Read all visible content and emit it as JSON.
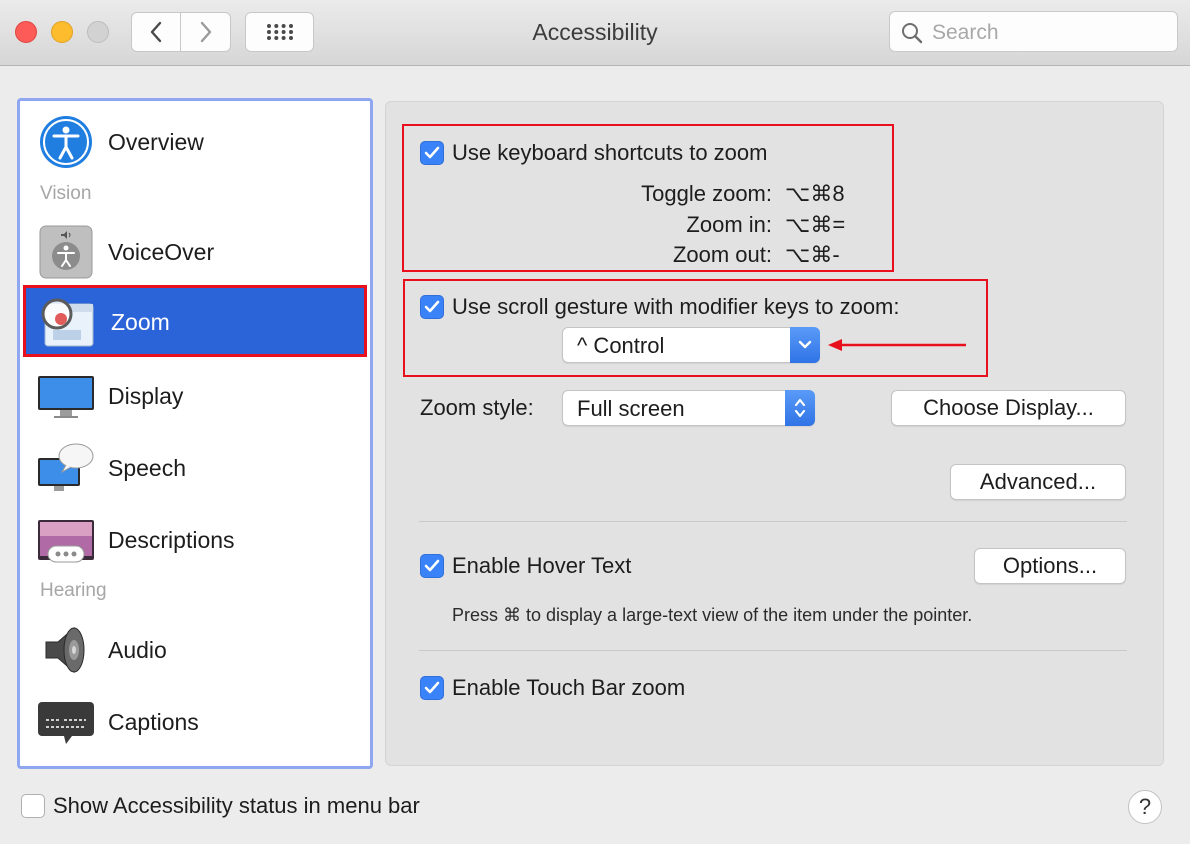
{
  "window": {
    "title": "Accessibility",
    "search_placeholder": "Search"
  },
  "sidebar": {
    "items": [
      {
        "label": "Overview",
        "icon": "accessibility-icon"
      },
      {
        "label": "VoiceOver",
        "icon": "voiceover-icon"
      },
      {
        "label": "Zoom",
        "icon": "zoom-icon",
        "selected": true
      },
      {
        "label": "Display",
        "icon": "display-icon"
      },
      {
        "label": "Speech",
        "icon": "speech-icon"
      },
      {
        "label": "Descriptions",
        "icon": "descriptions-icon"
      },
      {
        "label": "Audio",
        "icon": "speaker-icon"
      },
      {
        "label": "Captions",
        "icon": "captions-icon"
      }
    ],
    "headers": {
      "vision": "Vision",
      "hearing": "Hearing"
    }
  },
  "zoom": {
    "keyboard_shortcuts": {
      "label": "Use keyboard shortcuts to zoom",
      "checked": true,
      "shortcuts": [
        {
          "label": "Toggle zoom:",
          "keys": "⌥⌘8"
        },
        {
          "label": "Zoom in:",
          "keys": "⌥⌘="
        },
        {
          "label": "Zoom out:",
          "keys": "⌥⌘-"
        }
      ]
    },
    "scroll_gesture": {
      "label": "Use scroll gesture with modifier keys to zoom:",
      "checked": true,
      "modifier_value": "^ Control"
    },
    "zoom_style": {
      "label": "Zoom style:",
      "value": "Full screen"
    },
    "choose_display_button": "Choose Display...",
    "advanced_button": "Advanced...",
    "hover_text": {
      "label": "Enable Hover Text",
      "checked": true,
      "options_button": "Options...",
      "description": "Press ⌘ to display a large-text view of the item under the pointer."
    },
    "touch_bar_zoom": {
      "label": "Enable Touch Bar zoom",
      "checked": true
    }
  },
  "footer": {
    "status_label": "Show Accessibility status in menu bar",
    "status_checked": false,
    "help_label": "?"
  },
  "colors": {
    "selection": "#2b63d8",
    "annotation_red": "#e8101c",
    "checkbox_blue": "#3a82f7"
  }
}
